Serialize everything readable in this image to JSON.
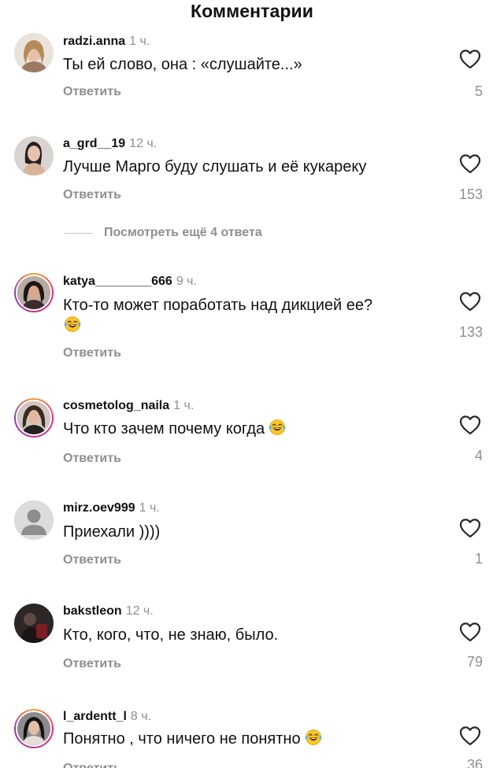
{
  "header": {
    "title": "Комментарии"
  },
  "more_replies": {
    "label": "Посмотреть ещё 4 ответа"
  },
  "reply_label": "Ответить",
  "comments": [
    {
      "username": "radzi.anna",
      "time": "1 ч.",
      "text": "Ты ей слово, она : «слушайте...»",
      "likes": "5",
      "avatar": "photo"
    },
    {
      "username": "a_grd__19",
      "time": "12 ч.",
      "text": "Лучше Марго буду слушать и её кукареку",
      "likes": "153",
      "avatar": "photo"
    },
    {
      "username": "katya________666",
      "time": "9 ч.",
      "text": "Кто-то может поработать над дикцией ее?",
      "emoji": "face-with-tears-of-joy",
      "likes": "133",
      "avatar": "photo-story-ring"
    },
    {
      "username": "cosmetolog_naila",
      "time": "1 ч.",
      "text": "Что кто зачем почему когда",
      "emoji": "face-with-tears-of-joy",
      "likes": "4",
      "avatar": "photo-story-ring"
    },
    {
      "username": "mirz.oev999",
      "time": "1 ч.",
      "text": "Приехали ))))",
      "likes": "1",
      "avatar": "default-user-icon"
    },
    {
      "username": "bakstleon",
      "time": "12 ч.",
      "text": "Кто, кого, что, не знаю, было.",
      "likes": "79",
      "avatar": "photo"
    },
    {
      "username": "l_ardentt_l",
      "time": "8 ч.",
      "text": "Понятно , что ничего не понятно",
      "emoji": "face-with-tears-of-joy",
      "likes": "36",
      "avatar": "photo-story-ring"
    }
  ],
  "colors": {
    "text": "#111111",
    "secondary": "#8e8e8e",
    "story_ring": "#ee2a7b"
  },
  "icons": {
    "like": "heart-outline-icon",
    "emoji": "face-with-tears-of-joy-icon"
  }
}
